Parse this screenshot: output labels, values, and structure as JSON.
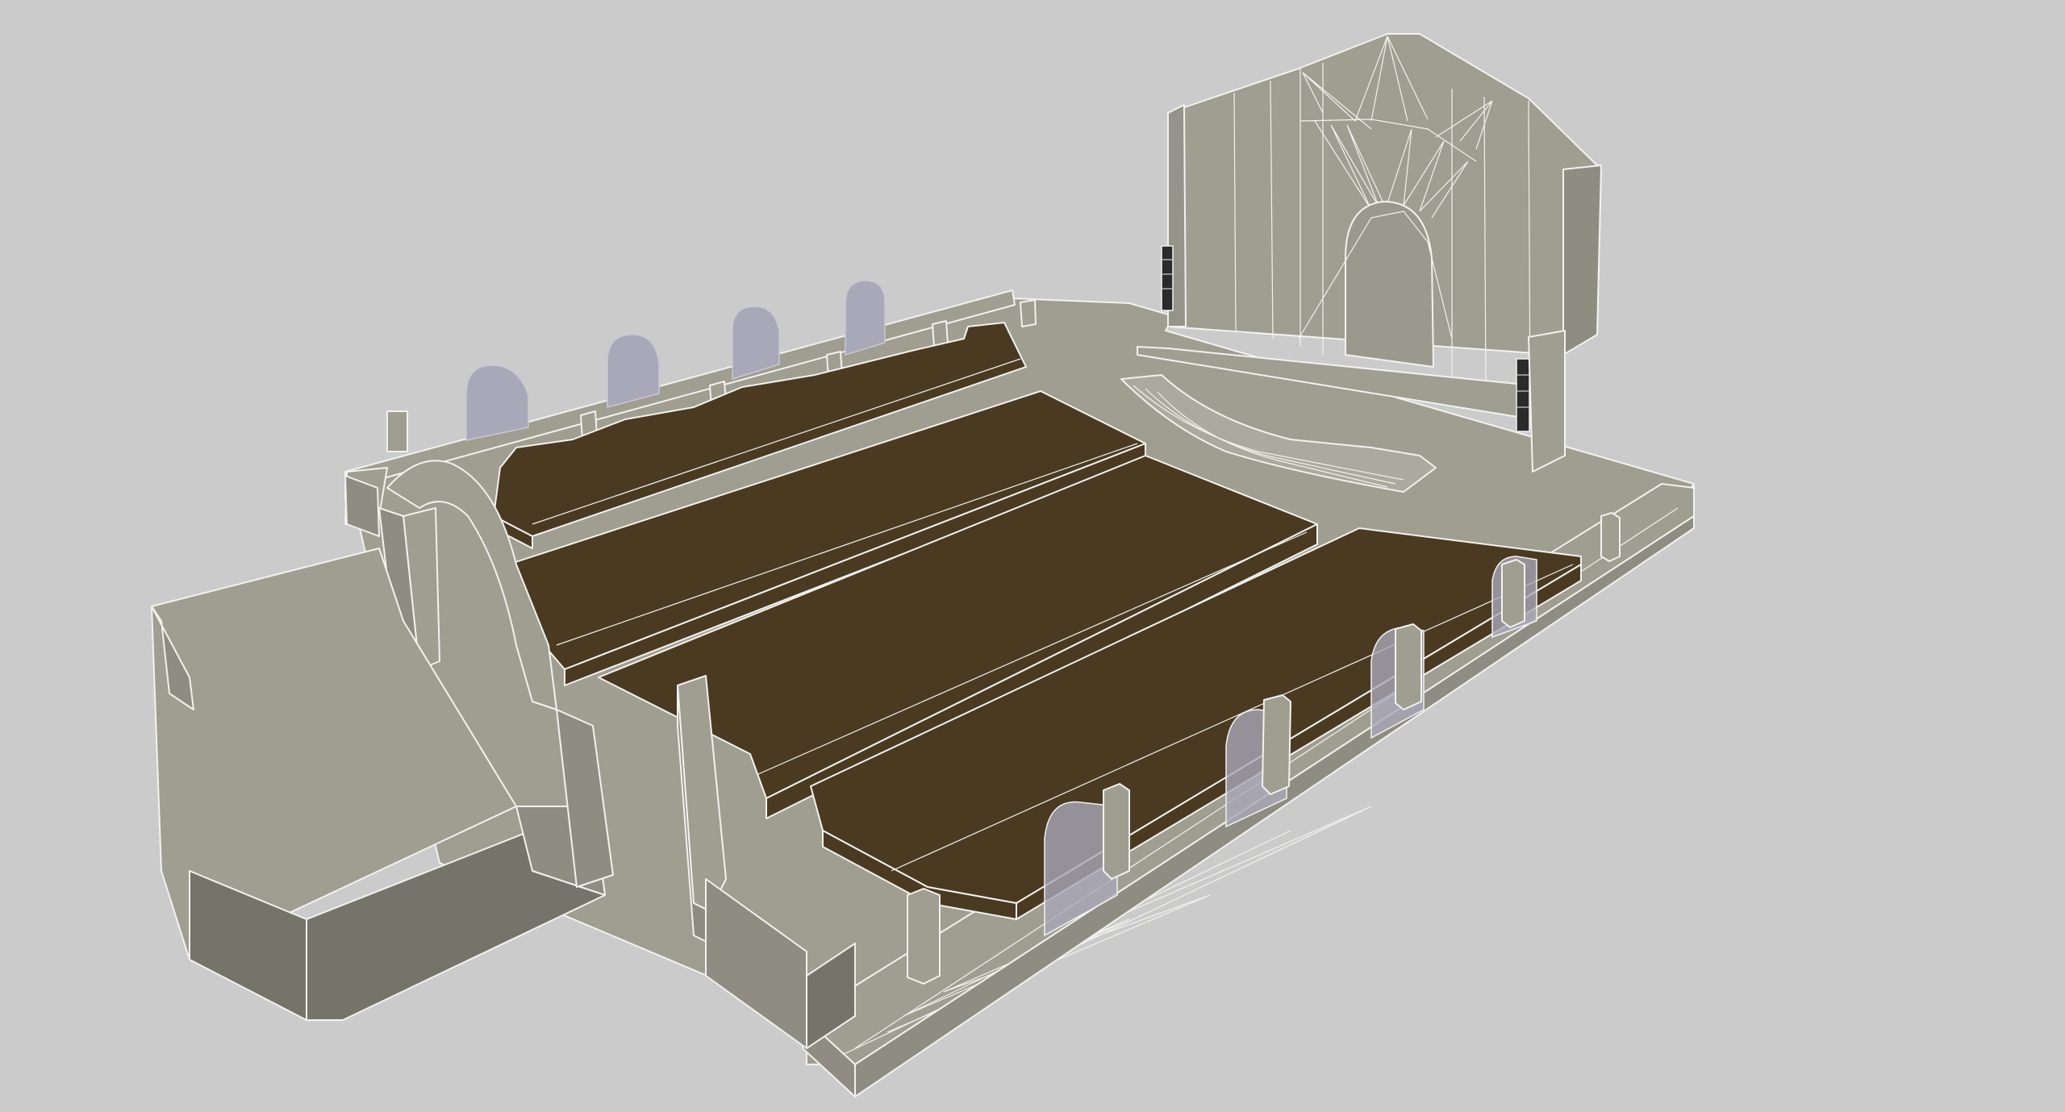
{
  "scene": {
    "kind": "3d-model-viewport",
    "subject": "auditorium-interior",
    "colors": {
      "background": "#cbcbcb",
      "wall_light": "#a09d91",
      "wall_mid": "#8f8c81",
      "wall_dark": "#76736a",
      "seating_block": "#4a3a22",
      "window_glass": "#a9a8b8",
      "edge_lines": "#f2f2ee",
      "speaker": "#2b2b2b"
    },
    "icons": [
      "arched-window-icon",
      "speaker-array-icon"
    ]
  }
}
